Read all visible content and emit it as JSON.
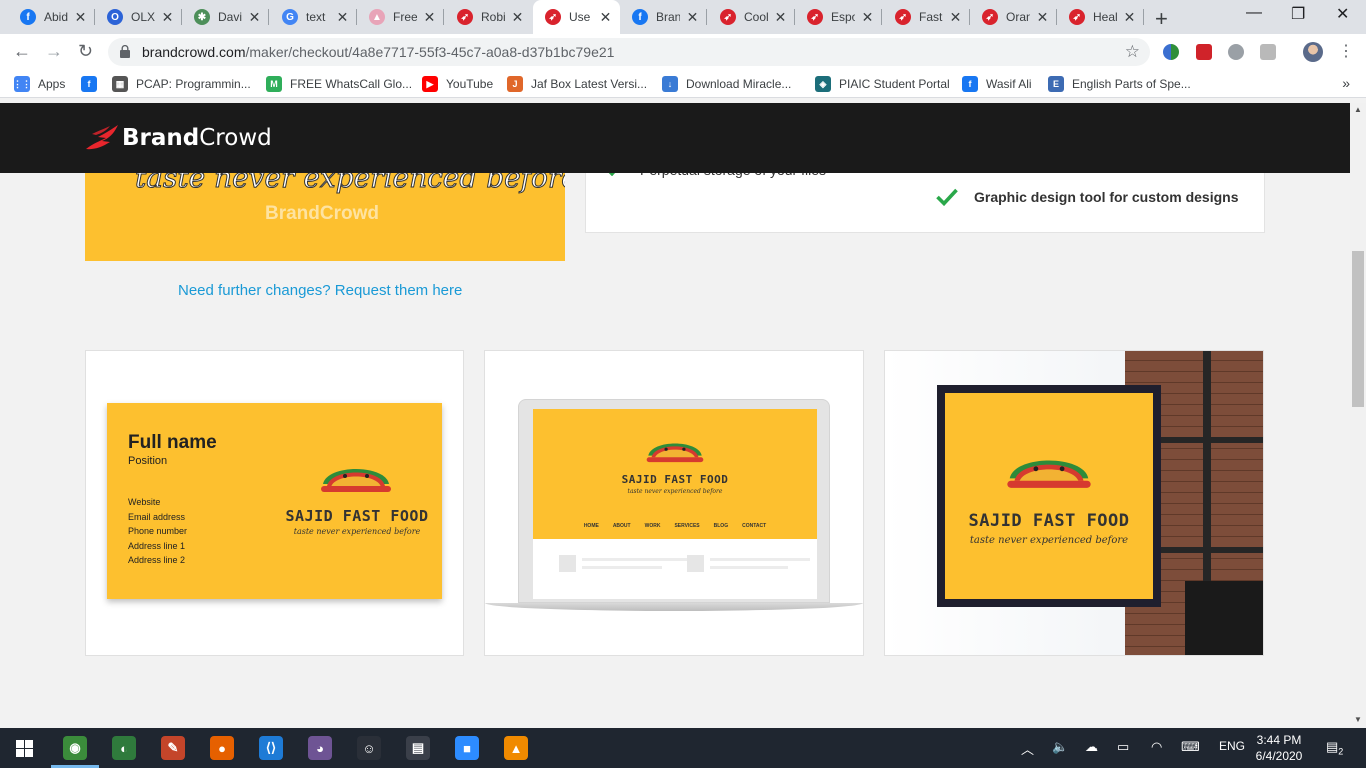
{
  "browser": {
    "tabs": [
      {
        "label": "Abid",
        "icon": "facebook-icon",
        "color": "#1877f2",
        "glyph": "f"
      },
      {
        "label": "OLX",
        "icon": "olx-icon",
        "color": "#2c63d7",
        "glyph": "O"
      },
      {
        "label": "Davi",
        "icon": "globe-icon",
        "color": "#4d8f5a",
        "glyph": "✱"
      },
      {
        "label": "text",
        "icon": "google-icon",
        "color": "#4285f4",
        "glyph": "G"
      },
      {
        "label": "Free",
        "icon": "image-icon",
        "color": "#e8a4b8",
        "glyph": "▲"
      },
      {
        "label": "Robi",
        "icon": "brandcrowd-icon",
        "color": "#d9232d",
        "glyph": "➶"
      },
      {
        "label": "Use",
        "icon": "brandcrowd-icon",
        "color": "#d9232d",
        "glyph": "➶"
      },
      {
        "label": "Bran",
        "icon": "facebook-icon",
        "color": "#1877f2",
        "glyph": "f"
      },
      {
        "label": "Cool",
        "icon": "brandcrowd-icon",
        "color": "#d9232d",
        "glyph": "➶"
      },
      {
        "label": "Espo",
        "icon": "brandcrowd-icon",
        "color": "#d9232d",
        "glyph": "➶"
      },
      {
        "label": "Fast",
        "icon": "brandcrowd-icon",
        "color": "#d9232d",
        "glyph": "➶"
      },
      {
        "label": "Oran",
        "icon": "brandcrowd-icon",
        "color": "#d9232d",
        "glyph": "➶"
      },
      {
        "label": "Heal",
        "icon": "brandcrowd-icon",
        "color": "#d9232d",
        "glyph": "➶"
      }
    ],
    "active_tab": 6,
    "url_host": "brandcrowd.com",
    "url_path": "/maker/checkout/4a8e7717-55f3-45c7-a0a8-d37b1bc79e21",
    "bookmarks": [
      {
        "label": "Apps",
        "icon": "apps-grid-icon",
        "color": "#4285f4",
        "glyph": "⋮⋮"
      },
      {
        "label": "",
        "icon": "facebook-icon",
        "color": "#1877f2",
        "glyph": "f"
      },
      {
        "label": "PCAP: Programmin...",
        "icon": "pcap-icon",
        "color": "#555555",
        "glyph": "▦"
      },
      {
        "label": "FREE WhatsCall Glo...",
        "icon": "whatscall-icon",
        "color": "#2fae5a",
        "glyph": "M"
      },
      {
        "label": "YouTube",
        "icon": "youtube-icon",
        "color": "#ff0000",
        "glyph": "▶"
      },
      {
        "label": "Jaf Box Latest Versi...",
        "icon": "jafbox-icon",
        "color": "#e0672a",
        "glyph": "J"
      },
      {
        "label": "Download Miracle...",
        "icon": "download-icon",
        "color": "#3a7bd5",
        "glyph": "↓"
      },
      {
        "label": "PIAIC Student Portal",
        "icon": "piaic-icon",
        "color": "#1c6e7a",
        "glyph": "◈"
      },
      {
        "label": "Wasif Ali",
        "icon": "facebook-icon",
        "color": "#1877f2",
        "glyph": "f"
      },
      {
        "label": "English Parts of Spe...",
        "icon": "english-icon",
        "color": "#3d6bb3",
        "glyph": "E"
      }
    ]
  },
  "site": {
    "brand_part1": "Brand",
    "brand_part2": "Crowd",
    "preview_tagline": "taste never experienced before",
    "preview_watermark": "BrandCrowd",
    "feature_partial": "Perpetual storage of your files",
    "feature_graphic": "Graphic design tool for custom designs",
    "request_link": "Need further changes? Request them here",
    "accent_color": "#fdc02f",
    "link_color": "#1a9ad6",
    "check_color": "#2aa84a"
  },
  "mockups": {
    "business_card": {
      "full_name": "Full name",
      "position": "Position",
      "website": "Website",
      "email": "Email address",
      "phone": "Phone number",
      "address1": "Address line 1",
      "address2": "Address line 2",
      "brand_name": "SAJID FAST FOOD",
      "brand_tagline": "taste never experienced before"
    },
    "laptop": {
      "brand_name": "SAJID FAST FOOD",
      "brand_tagline": "taste never experienced before",
      "nav": [
        "HOME",
        "ABOUT",
        "WORK",
        "SERVICES",
        "BLOG",
        "CONTACT"
      ]
    },
    "sign": {
      "brand_name": "SAJID FAST FOOD",
      "brand_tagline": "taste never experienced before"
    }
  },
  "taskbar": {
    "time": "3:44 PM",
    "date": "6/4/2020",
    "language": "ENG",
    "notifications": "2",
    "apps": [
      {
        "name": "chrome-icon",
        "color": "#3b8c3b",
        "glyph": "◉"
      },
      {
        "name": "globe-app-icon",
        "color": "#2f7a3c",
        "glyph": "◐"
      },
      {
        "name": "paint-app-icon",
        "color": "#c4452a",
        "glyph": "✎"
      },
      {
        "name": "firefox-icon",
        "color": "#e66000",
        "glyph": "●"
      },
      {
        "name": "vscode-icon",
        "color": "#1e7bd6",
        "glyph": "⟨⟩"
      },
      {
        "name": "github-desktop-icon",
        "color": "#6e5494",
        "glyph": "◕"
      },
      {
        "name": "emoji-app-icon",
        "color": "#2a2f38",
        "glyph": "☺"
      },
      {
        "name": "photos-app-icon",
        "color": "#3a3f49",
        "glyph": "▤"
      },
      {
        "name": "zoom-icon",
        "color": "#2d8cff",
        "glyph": "■"
      },
      {
        "name": "vlc-icon",
        "color": "#f08a00",
        "glyph": "▲"
      }
    ]
  }
}
